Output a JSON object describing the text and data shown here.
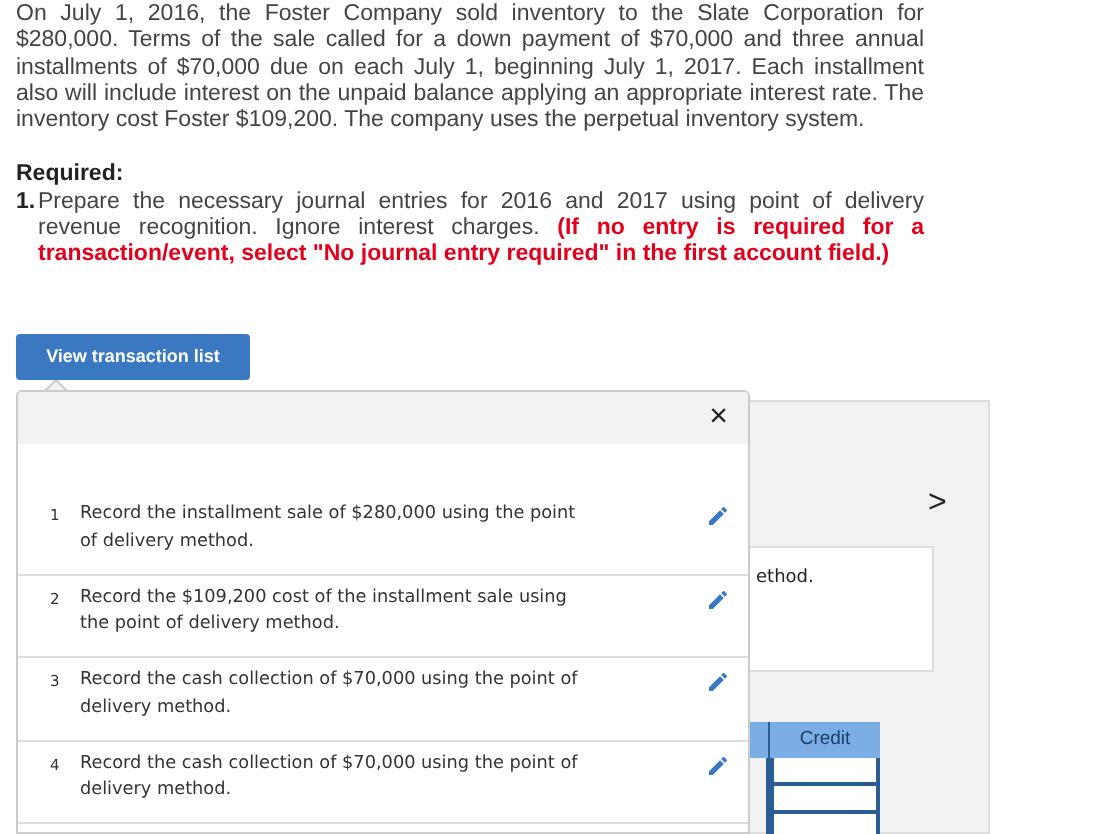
{
  "problem": "On July 1, 2016, the Foster Company sold inventory to the Slate Corporation for $280,000. Terms of the sale called for a down payment of $70,000 and three annual installments of $70,000 due on each July 1, beginning July 1, 2017. Each installment also will include interest on the unpaid balance applying an appropriate interest rate. The inventory cost Foster $109,200. The company uses the perpetual inventory system.",
  "required": {
    "heading": "Required:",
    "number": "1.",
    "text": "Prepare the necessary journal entries for 2016 and 2017 using point of delivery revenue recognition. Ignore interest charges.",
    "note": "(If no entry is required for a transaction/event, select \"No journal entry required\" in the first account field.)"
  },
  "view_button": "View transaction list",
  "popup": {
    "close": "×",
    "transactions": [
      {
        "number": "1",
        "text": "Record the installment sale of $280,000 using the point of delivery method."
      },
      {
        "number": "2",
        "text": "Record the $109,200 cost of the installment sale using the point of delivery method."
      },
      {
        "number": "3",
        "text": "Record the cash collection of $70,000 using the point of delivery method."
      },
      {
        "number": "4",
        "text": "Record the cash collection of $70,000 using the point of delivery method."
      }
    ]
  },
  "background_panel": {
    "next": ">",
    "description": "ethod.",
    "table": {
      "columns": [
        "Credit"
      ]
    }
  }
}
